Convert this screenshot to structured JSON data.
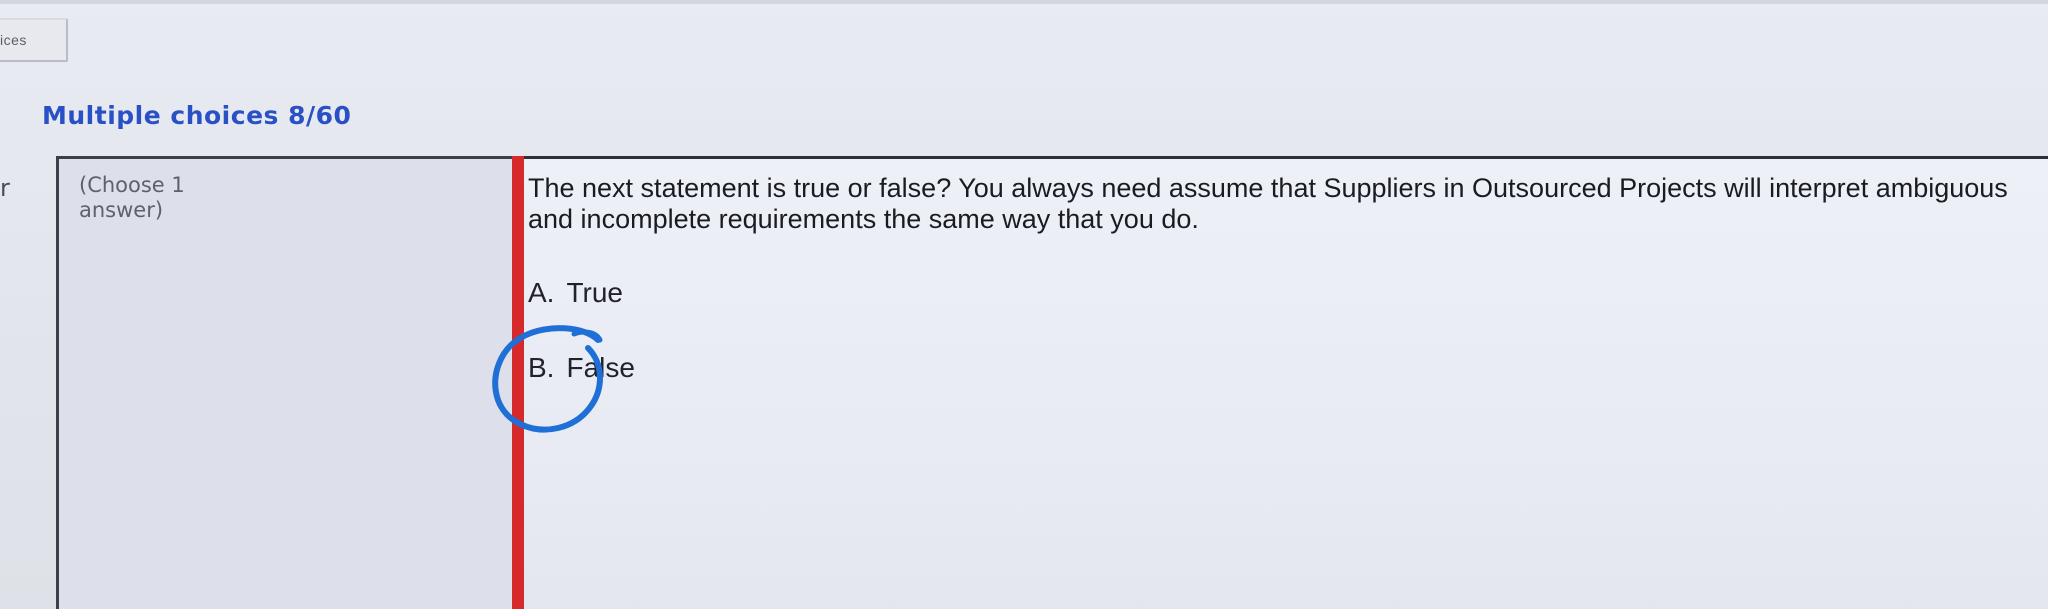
{
  "tab": {
    "label": "ices"
  },
  "header": {
    "title": "Multiple choices 8/60"
  },
  "row_marker": "r",
  "left_panel": {
    "instruction": "(Choose 1\nanswer)"
  },
  "question": {
    "text": "The next statement is true or false? You always need assume that Suppliers in Outsourced Projects will interpret ambiguous and incomplete requirements the same way that you do.",
    "options": [
      {
        "letter": "A.",
        "label": "True"
      },
      {
        "letter": "B.",
        "label": "False"
      }
    ]
  },
  "annotation": {
    "color": "#1f6fd6",
    "marks_option": "B."
  },
  "colors": {
    "title": "#2a50c6",
    "accent_bar": "#d62a2a"
  }
}
